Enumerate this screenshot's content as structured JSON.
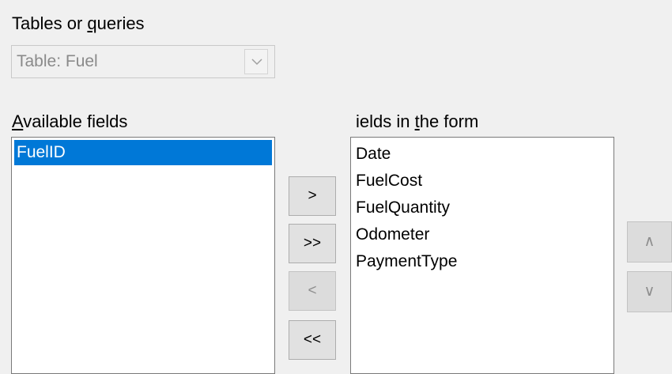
{
  "tables_label": {
    "before": "Tables or ",
    "mnemonic": "q",
    "after": "ueries"
  },
  "table_select": {
    "value": "Table: Fuel"
  },
  "available": {
    "label_mnemonic": "A",
    "label_rest": "vailable fields",
    "items": [
      "FuelID"
    ],
    "selected_index": 0
  },
  "form_fields": {
    "label_a": "ields in ",
    "label_mnemonic": "t",
    "label_b": "he form",
    "items": [
      "Date",
      "FuelCost",
      "FuelQuantity",
      "Odometer",
      "PaymentType"
    ]
  },
  "move_buttons": {
    "add_one": ">",
    "add_all": ">>",
    "remove_one": "<",
    "remove_all": "<<"
  },
  "order_buttons": {
    "up": "∧",
    "down": "∨"
  },
  "colors": {
    "selection": "#0078d7",
    "disabled_text": "#8f8f8f"
  }
}
